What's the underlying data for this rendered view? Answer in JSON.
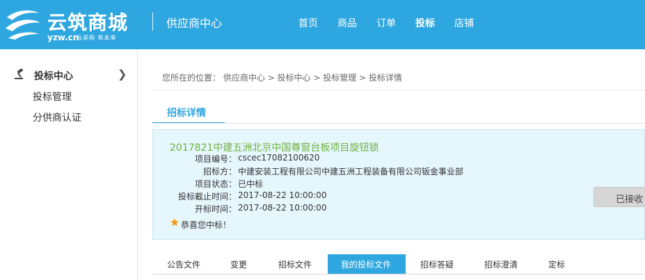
{
  "header": {
    "logo_title": "云筑商城",
    "logo_domain": "yzw.cn",
    "logo_slogan": "云采购 筑未来",
    "center_name": "供应商中心",
    "nav": [
      "首页",
      "商品",
      "订单",
      "投标",
      "店铺"
    ],
    "active_nav": "投标"
  },
  "sidebar": {
    "section_label": "投标中心",
    "items": [
      "投标管理",
      "分供商认证"
    ]
  },
  "breadcrumb": {
    "prefix": "您所在的位置：",
    "path": "供应商中心 > 投标中心 > 投标管理 > 投标详情"
  },
  "main_tab": "招标详情",
  "project": {
    "title": "2017821中建五洲北京中国尊窗台板项目旋钮锁",
    "fields": [
      {
        "label": "项目编号：",
        "value": "cscec17082100620"
      },
      {
        "label": "招标方：",
        "value": "中建安装工程有限公司中建五洲工程装备有限公司钣金事业部"
      },
      {
        "label": "项目状态：",
        "value": "已中标"
      },
      {
        "label": "投标截止时间：",
        "value": "2017-08-22 10:00:00"
      },
      {
        "label": "开标时间：",
        "value": "2017-08-22 10:00:00"
      }
    ],
    "congrats": "恭喜您中标！",
    "status_button": "已接收"
  },
  "sub_tabs": [
    "公告文件",
    "变更",
    "招标文件",
    "我的投标文件",
    "招标答疑",
    "招标澄清",
    "定标"
  ],
  "active_sub_tab": "我的投标文件",
  "colors": {
    "brand_blue": "#2ea7e0",
    "title_green": "#6db33f",
    "card_bg": "#e6f6fd"
  }
}
